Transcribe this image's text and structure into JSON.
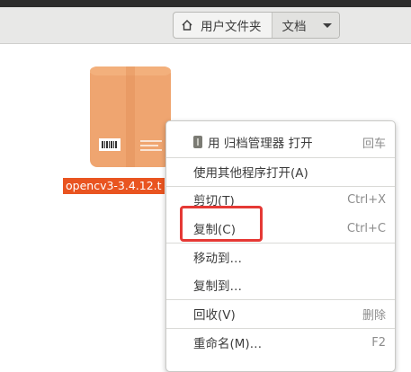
{
  "header": {
    "breadcrumbs": [
      {
        "label": "用户文件夹"
      },
      {
        "label": "文档"
      }
    ]
  },
  "file": {
    "name": "opencv3-3.4.12.t"
  },
  "context_menu": {
    "items": [
      {
        "label": "用 归档管理器 打开",
        "accel": "回车"
      },
      {
        "label": "使用其他程序打开(A)",
        "accel": ""
      },
      {
        "label": "剪切(T)",
        "accel": "Ctrl+X"
      },
      {
        "label": "复制(C)",
        "accel": "Ctrl+C"
      },
      {
        "label": "移动到…",
        "accel": ""
      },
      {
        "label": "复制到…",
        "accel": ""
      },
      {
        "label": "回收(V)",
        "accel": "删除"
      },
      {
        "label": "重命名(M)…",
        "accel": "F2"
      }
    ]
  },
  "colors": {
    "selection": "#e95420",
    "annotation": "#e53935",
    "archive_light": "#f0a976",
    "archive_dark": "#e9955d"
  }
}
